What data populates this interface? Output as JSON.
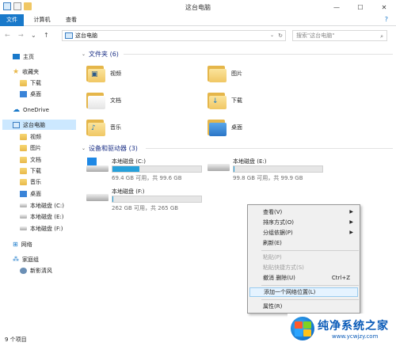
{
  "window": {
    "title": "这台电脑",
    "minimize": "—",
    "maximize": "☐",
    "close": "✕"
  },
  "ribbon": {
    "tabs": [
      "文件",
      "计算机",
      "查看"
    ],
    "help": "?"
  },
  "nav": {
    "back": "←",
    "forward": "→",
    "recent": "⌄",
    "up": "↑"
  },
  "address": {
    "text": "这台电脑",
    "dropdown": "⌄",
    "refresh": "↻"
  },
  "search": {
    "placeholder": "搜索\"这台电脑\""
  },
  "sidebar": {
    "items": [
      "主页",
      "收藏夹",
      "下载",
      "桌面",
      "OneDrive",
      "这台电脑",
      "视频",
      "图片",
      "文档",
      "下载",
      "音乐",
      "桌面",
      "本地磁盘 (C:)",
      "本地磁盘 (E:)",
      "本地磁盘 (F:)",
      "网络",
      "家庭组",
      "新影清风"
    ]
  },
  "folders": {
    "header": "文件夹 (6)",
    "items": [
      "视频",
      "图片",
      "文档",
      "下载",
      "音乐",
      "桌面"
    ]
  },
  "drives": {
    "header": "设备和驱动器 (3)",
    "items": [
      {
        "name": "本地磁盘 (C:)",
        "free": "69.4 GB 可用，共 99.6 GB",
        "used": 0.3
      },
      {
        "name": "本地磁盘 (E:)",
        "free": "99.8 GB 可用，共 99.9 GB",
        "used": 0.01
      },
      {
        "name": "本地磁盘 (F:)",
        "free": "262 GB 可用，共 265 GB",
        "used": 0.01
      }
    ]
  },
  "status": {
    "count": "9 个项目"
  },
  "context_menu": {
    "items": [
      "查看(V)",
      "排序方式(O)",
      "分组依据(P)",
      "刷新(E)",
      "粘贴(P)",
      "粘贴快捷方式(S)",
      "撤消 删除(U)",
      "添加一个网络位置(L)",
      "属性(R)"
    ],
    "shortcut": "Ctrl+Z"
  },
  "watermark": {
    "title": "纯净系统之家",
    "url": "www.ycwjzy.com"
  },
  "colors": {
    "accent": "#1979ca",
    "drive_bar": "#26a0da"
  }
}
